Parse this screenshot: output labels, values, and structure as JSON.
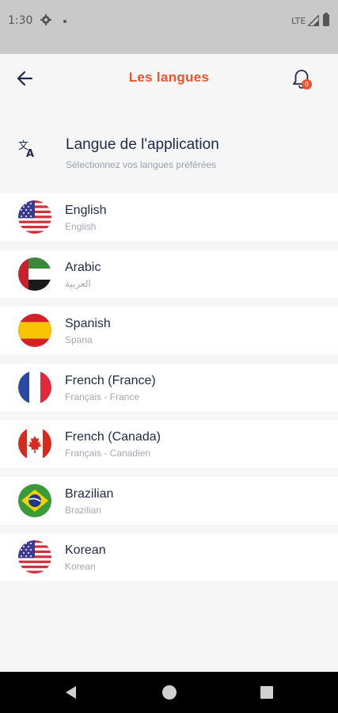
{
  "status_bar": {
    "time": "1:30",
    "network": "LTE",
    "icons": [
      "settings-icon",
      "dot-icon",
      "signal-icon",
      "battery-icon"
    ]
  },
  "app_bar": {
    "title": "Les langues",
    "notification_count": "0",
    "icons": [
      "arrow-back-icon",
      "bell-icon"
    ]
  },
  "section": {
    "title": "Langue de l'application",
    "subtitle": "Sélectionnez vos langues préférées",
    "icon": "translate-icon"
  },
  "languages": [
    {
      "name": "English",
      "native": "English",
      "flag": "us-flag-icon"
    },
    {
      "name": "Arabic",
      "native": "العربية",
      "flag": "uae-flag-icon"
    },
    {
      "name": "Spanish",
      "native": "Spana",
      "flag": "spain-flag-icon"
    },
    {
      "name": "French (France)",
      "native": "Français - France",
      "flag": "france-flag-icon"
    },
    {
      "name": "French (Canada)",
      "native": "Français - Canadien",
      "flag": "canada-flag-icon"
    },
    {
      "name": "Brazilian",
      "native": "Brazilian",
      "flag": "brazil-flag-icon"
    },
    {
      "name": "Korean",
      "native": "Korean",
      "flag": "us-flag-icon"
    }
  ],
  "colors": {
    "accent": "#e8542f",
    "text_primary": "#1e2a4a",
    "text_secondary": "#a4a8b3",
    "background": "#f6f6f6"
  }
}
